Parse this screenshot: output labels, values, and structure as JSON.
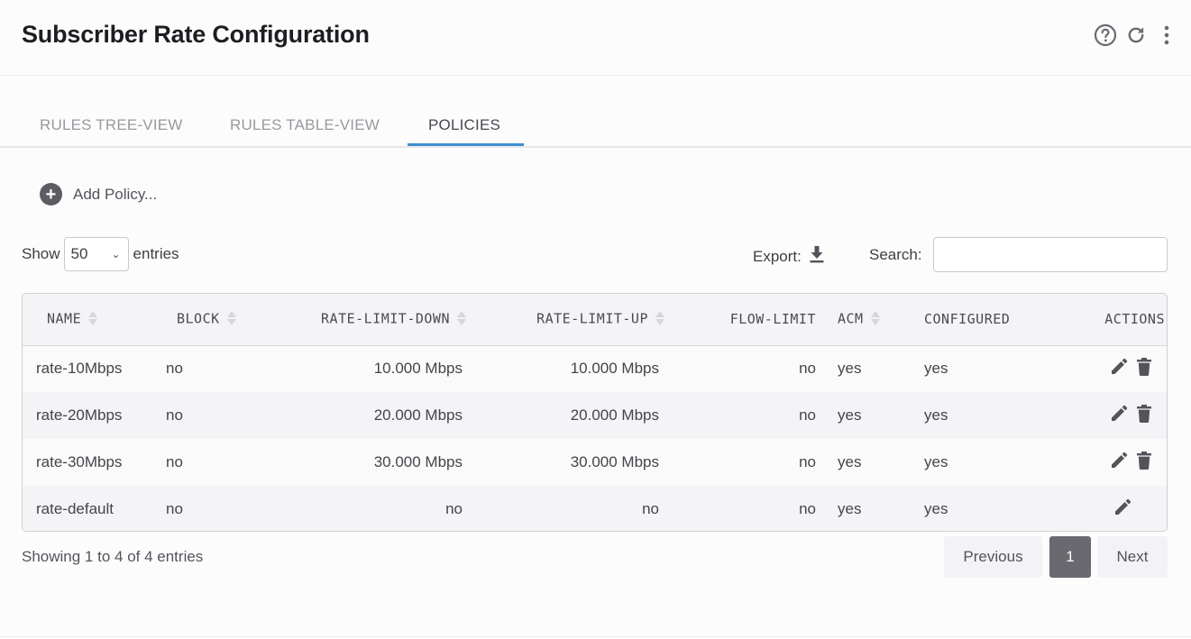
{
  "header": {
    "title": "Subscriber Rate Configuration",
    "icons": [
      "help-icon",
      "refresh-icon",
      "more-vertical-icon"
    ]
  },
  "tabs": [
    {
      "label": "RULES TREE-VIEW",
      "active": false
    },
    {
      "label": "RULES TABLE-VIEW",
      "active": false
    },
    {
      "label": "POLICIES",
      "active": true
    }
  ],
  "accent_color": "#3d8ed0",
  "add_policy": {
    "label": "Add Policy..."
  },
  "length": {
    "show_label": "Show",
    "value": "50",
    "entries_label": "entries"
  },
  "export": {
    "label": "Export:"
  },
  "search": {
    "label": "Search:",
    "value": ""
  },
  "table": {
    "columns": [
      "NAME",
      "BLOCK",
      "RATE-LIMIT-DOWN",
      "RATE-LIMIT-UP",
      "FLOW-LIMIT",
      "ACM",
      "CONFIGURED",
      "ACTIONS"
    ],
    "rows": [
      {
        "name": "rate-10Mbps",
        "block": "no",
        "down": "10.000 Mbps",
        "up": "10.000 Mbps",
        "flow": "no",
        "acm": "yes",
        "configured": "yes",
        "can_delete": true
      },
      {
        "name": "rate-20Mbps",
        "block": "no",
        "down": "20.000 Mbps",
        "up": "20.000 Mbps",
        "flow": "no",
        "acm": "yes",
        "configured": "yes",
        "can_delete": true
      },
      {
        "name": "rate-30Mbps",
        "block": "no",
        "down": "30.000 Mbps",
        "up": "30.000 Mbps",
        "flow": "no",
        "acm": "yes",
        "configured": "yes",
        "can_delete": true
      },
      {
        "name": "rate-default",
        "block": "no",
        "down": "no",
        "up": "no",
        "flow": "no",
        "acm": "yes",
        "configured": "yes",
        "can_delete": false
      }
    ]
  },
  "footer": {
    "info": "Showing 1 to 4 of 4 entries",
    "previous": "Previous",
    "page": "1",
    "next": "Next"
  }
}
